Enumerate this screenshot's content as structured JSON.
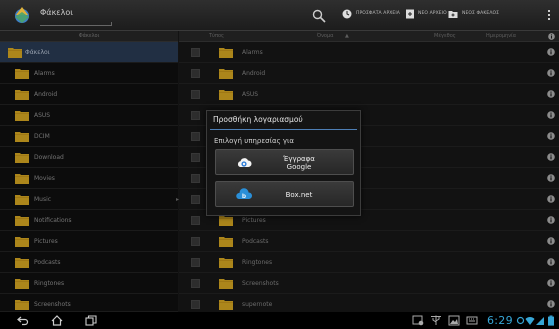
{
  "header": {
    "title": "Φάκελοι",
    "actions": [
      {
        "label": "ΠΡΟΣΦΑΤΑ ΑΡΧΕΙΑ",
        "icon": "clock-icon"
      },
      {
        "label": "ΝΕΟ ΑΡΧΕΙΟ",
        "icon": "new-file-icon"
      },
      {
        "label": "ΝΕΟΣ ΦΑΚΕΛΟΣ",
        "icon": "new-folder-icon"
      }
    ],
    "search_icon": "search-icon",
    "menu_icon": "overflow-menu-icon"
  },
  "left_panel": {
    "header": "Φάκελοι",
    "root_label": "Φάκελοι",
    "items": [
      {
        "label": "Alarms"
      },
      {
        "label": "Android"
      },
      {
        "label": "ASUS"
      },
      {
        "label": "DCIM"
      },
      {
        "label": "Download"
      },
      {
        "label": "Movies"
      },
      {
        "label": "Music"
      },
      {
        "label": "Notifications"
      },
      {
        "label": "Pictures"
      },
      {
        "label": "Podcasts"
      },
      {
        "label": "Ringtones"
      },
      {
        "label": "Screenshots"
      }
    ]
  },
  "file_list": {
    "columns": {
      "type": "Τύπος",
      "name": "Όνομα",
      "sort_indicator": "▲",
      "size": "Μέγεθος",
      "date": "Ημερομηνία"
    },
    "rows": [
      {
        "name": "Alarms"
      },
      {
        "name": "Android"
      },
      {
        "name": "ASUS"
      },
      {
        "name": ""
      },
      {
        "name": ""
      },
      {
        "name": ""
      },
      {
        "name": ""
      },
      {
        "name": ""
      },
      {
        "name": "Pictures"
      },
      {
        "name": "Podcasts"
      },
      {
        "name": "Ringtones"
      },
      {
        "name": "Screenshots"
      },
      {
        "name": "supernote"
      }
    ]
  },
  "dialog": {
    "title": "Προσθήκη λογαριασμού",
    "subtitle": "Επιλογή υπηρεσίας για",
    "options": [
      {
        "label_line1": "Έγγραφα",
        "label_line2": "Google",
        "icon": "google-docs-cloud-icon"
      },
      {
        "label": "Box.net",
        "icon": "box-net-icon"
      }
    ]
  },
  "system_bar": {
    "time": "6:29",
    "colors": {
      "accent": "#37a6d6"
    }
  },
  "colors": {
    "folder": "#e6b325",
    "selected_row": "#2c3f5a",
    "dialog_rule": "#4e7fb5"
  }
}
